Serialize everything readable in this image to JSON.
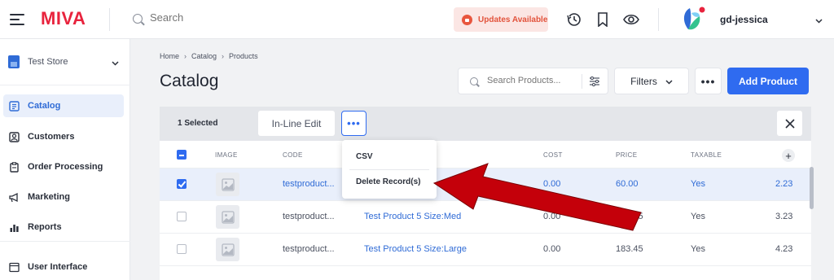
{
  "header": {
    "brand": "MIVA",
    "search_placeholder": "Search",
    "updates_label": "Updates Available",
    "user_name": "gd-jessica"
  },
  "sidebar": {
    "store_name": "Test Store",
    "items": [
      {
        "label": "Catalog",
        "icon": "catalog-icon",
        "active": true
      },
      {
        "label": "Customers",
        "icon": "customers-icon",
        "active": false
      },
      {
        "label": "Order Processing",
        "icon": "order-processing-icon",
        "active": false
      },
      {
        "label": "Marketing",
        "icon": "marketing-icon",
        "active": false
      },
      {
        "label": "Reports",
        "icon": "reports-icon",
        "active": false
      },
      {
        "label": "User Interface",
        "icon": "user-interface-icon",
        "active": false
      }
    ]
  },
  "breadcrumb": [
    "Home",
    "Catalog",
    "Products"
  ],
  "page": {
    "title": "Catalog",
    "search_placeholder": "Search Products...",
    "filters_label": "Filters",
    "more_label": "•••",
    "add_label": "Add Product"
  },
  "selection": {
    "count_label": "1 Selected",
    "inline_edit_label": "In-Line Edit",
    "more_label": "•••",
    "close_label": "✕"
  },
  "table": {
    "columns": [
      "IMAGE",
      "CODE",
      "COST",
      "PRICE",
      "TAXABLE"
    ],
    "add_column_label": "+",
    "rows": [
      {
        "code": "testproduct...",
        "name": "",
        "cost": "0.00",
        "price": "60.00",
        "taxable": "Yes",
        "weight": "2.23",
        "selected": true
      },
      {
        "code": "testproduct...",
        "name": "Test Product 5 Size:Med",
        "cost": "0.00",
        "price": "183.45",
        "taxable": "Yes",
        "weight": "3.23",
        "selected": false
      },
      {
        "code": "testproduct...",
        "name": "Test Product 5 Size:Large",
        "cost": "0.00",
        "price": "183.45",
        "taxable": "Yes",
        "weight": "4.23",
        "selected": false
      }
    ]
  },
  "dropdown": {
    "items": [
      "CSV",
      "Delete Record(s)"
    ]
  },
  "colors": {
    "brand": "#e8233d",
    "accent": "#2f6bf0",
    "annotation_arrow": "#c4000a"
  }
}
